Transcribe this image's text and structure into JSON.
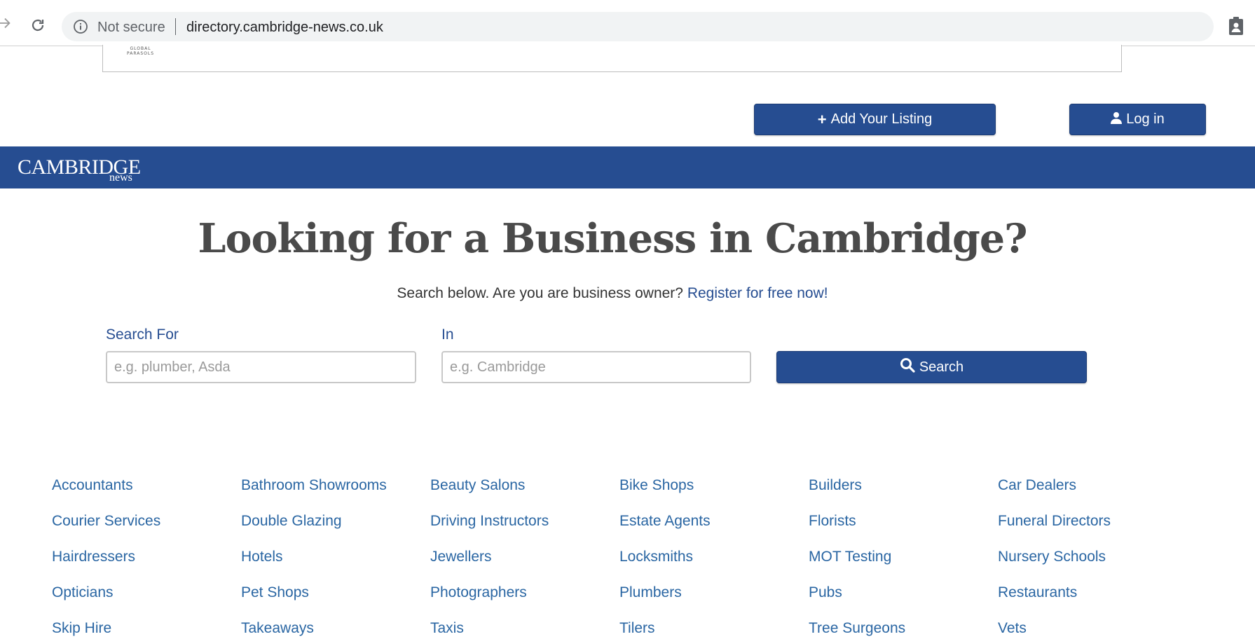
{
  "browser": {
    "security_label": "Not secure",
    "url": "directory.cambridge-news.co.uk"
  },
  "ad": {
    "logo_line1": "GLOBAL",
    "logo_line2": "PARASOLS"
  },
  "top_actions": {
    "add_listing_label": "Add Your Listing",
    "login_label": "Log in"
  },
  "brand": {
    "name": "CAMBRIDGE",
    "sub": "news"
  },
  "hero": {
    "title": "Looking for a Business in Cambridge?",
    "subtitle": "Search below. Are you are business owner?",
    "register_link": "Register for free now!"
  },
  "search": {
    "what_label": "Search For",
    "what_placeholder": "e.g. plumber, Asda",
    "where_label": "In",
    "where_placeholder": "e.g. Cambridge",
    "button_label": "Search"
  },
  "categories": [
    "Accountants",
    "Bathroom Showrooms",
    "Beauty Salons",
    "Bike Shops",
    "Builders",
    "Car Dealers",
    "Courier Services",
    "Double Glazing",
    "Driving Instructors",
    "Estate Agents",
    "Florists",
    "Funeral Directors",
    "Hairdressers",
    "Hotels",
    "Jewellers",
    "Locksmiths",
    "MOT Testing",
    "Nursery Schools",
    "Opticians",
    "Pet Shops",
    "Photographers",
    "Plumbers",
    "Pubs",
    "Restaurants",
    "Skip Hire",
    "Takeaways",
    "Taxis",
    "Tilers",
    "Tree Surgeons",
    "Vets"
  ],
  "colors": {
    "brand_blue": "#264d91",
    "link_blue": "#2a66a3",
    "heading_gray": "#4a4a4a"
  }
}
